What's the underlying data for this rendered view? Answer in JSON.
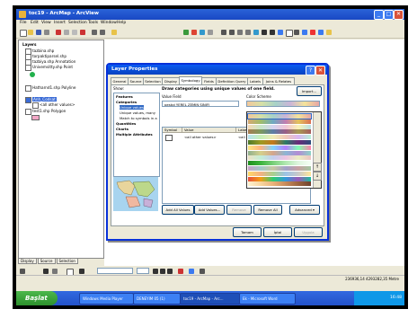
{
  "window": {
    "title": "toc19 - ArcMap - ArcView",
    "min": "_",
    "max": "□",
    "close": "✕"
  },
  "menu": [
    "File",
    "Edit",
    "View",
    "Insert",
    "Selection",
    "Tools",
    "Window",
    "Help"
  ],
  "toc": {
    "root": "Layers",
    "layers": [
      {
        "label": "tazbina.shp",
        "color": "#ffffff"
      },
      {
        "label": "torpaktiparsel.shp",
        "color": "#ffffff"
      },
      {
        "label": "tazbiya.shp Annotation",
        "color": "#ffffff"
      },
      {
        "label": "Univemsitty.shp Point",
        "color": "#ffffff"
      },
      {
        "label": "",
        "color": "#22b14c"
      },
      {
        "label": "Hatharnd1.shp Polyline",
        "color": "#ffffff"
      },
      {
        "label": "Anh_Codsat",
        "color": "#3a6bd6",
        "selected": true
      },
      {
        "label": "<all other values>",
        "color": "#ffffff"
      },
      {
        "label": "test1.shp Polygon",
        "color": "#ffffff"
      },
      {
        "label": "",
        "color": "#f2a7c6"
      }
    ],
    "tabs": [
      "Display",
      "Source",
      "Selection"
    ]
  },
  "dialog": {
    "title": "Layer Properties",
    "help": "?",
    "close": "✕",
    "tabs": [
      "General",
      "Source",
      "Selection",
      "Display",
      "Symbology",
      "Fields",
      "Definition Query",
      "Labels",
      "Joins & Relates"
    ],
    "active_tab": "Symbology",
    "show_label": "Show:",
    "show_items": [
      {
        "label": "Features",
        "bold": true
      },
      {
        "label": "Categories",
        "bold": true
      },
      {
        "label": "Unique values",
        "bold": false,
        "selected": true
      },
      {
        "label": "Unique values, many",
        "bold": false
      },
      {
        "label": "Match to symbols in a",
        "bold": false
      },
      {
        "label": "Quantities",
        "bold": true
      },
      {
        "label": "Charts",
        "bold": true
      },
      {
        "label": "Multiple Attributes",
        "bold": true
      }
    ],
    "heading": "Draw categories using unique values of one field.",
    "import_button": "Import...",
    "value_field_label": "Value Field",
    "value_field": "pestqi YEREL ZEMIN SINIFI",
    "color_scheme_label": "Color Scheme",
    "columns": [
      "Symbol",
      "Value",
      "Label"
    ],
    "rows": [
      {
        "value": "<all other values>",
        "label": "<all other values>"
      }
    ],
    "buttons": {
      "add_all": "Add All Values",
      "add": "Add Values...",
      "remove": "Remove",
      "remove_all": "Remove All",
      "advanced": "Advanced ▾"
    },
    "ok": "Tamam",
    "cancel": "İptal",
    "apply": "Uygula"
  },
  "color_schemes": [
    [
      "#f2c79b",
      "#d6e0a6",
      "#a6d2c8",
      "#cbb4d8",
      "#f4e49a",
      "#e7a5a5"
    ],
    [
      "#d5a873",
      "#9fbd6a",
      "#6ea9c2",
      "#c17bb1",
      "#e3c35c",
      "#d96f54"
    ],
    [
      "#f6d9b4",
      "#c9e7c7",
      "#d4d4f1",
      "#f0c4d6",
      "#fbf2b6",
      "#b9e0e4"
    ],
    [
      "#a67c52",
      "#7d9a5c",
      "#5c7da6",
      "#9a5c86",
      "#a69a52",
      "#a65c5c"
    ],
    [
      "#b7e3f1",
      "#c8f1b7",
      "#f1ecb7",
      "#f1c8b7",
      "#dab7f1",
      "#b7f1d8"
    ],
    [
      "#4d7a2a",
      "#9c9a22",
      "#c4781d",
      "#2a7a6a",
      "#6a2a7a",
      "#2a4d7a"
    ],
    [
      "#ffe680",
      "#ffb380",
      "#80d4ff",
      "#b380ff",
      "#80ffb3",
      "#ff80aa"
    ],
    [
      "#8fb08c",
      "#d4d08c",
      "#d4a58c",
      "#8cb5d4",
      "#b38cd4",
      "#8cd4c6"
    ],
    [
      "#ede2c3",
      "#c3edd5",
      "#c3cfed",
      "#edc3e1",
      "#e9edc3",
      "#edc3c3"
    ],
    [
      "#1e8f1e",
      "#3cb43c",
      "#7ad07a",
      "#b0e8b0",
      "#dff5df",
      "#f5fff5"
    ],
    [
      "#c8a2c8",
      "#a2c8c8",
      "#c8c8a2",
      "#a2a2c8",
      "#c8a2a2",
      "#a2c8a2"
    ],
    [
      "#ffd966",
      "#f4b183",
      "#a9d08e",
      "#9dc3e6",
      "#c9c9c9",
      "#ffe699"
    ],
    [
      "#e74c3c",
      "#f39c12",
      "#2ecc71",
      "#3498db",
      "#9b59b6",
      "#1abc9c"
    ],
    [
      "#fdf2d0",
      "#f8d6a0",
      "#e9b27a",
      "#c88a5a",
      "#9c6440",
      "#6e4230"
    ]
  ],
  "status": {
    "coords": "236936,14  4293282,35 Metre"
  },
  "taskbar": {
    "start": "Başlat",
    "tasks": [
      "Windows Media Player",
      "DENEYIM 05 (1)",
      "toc19 - ArcMap - Arc...",
      "Ek - Microsoft Word"
    ],
    "clock": "16:48"
  }
}
